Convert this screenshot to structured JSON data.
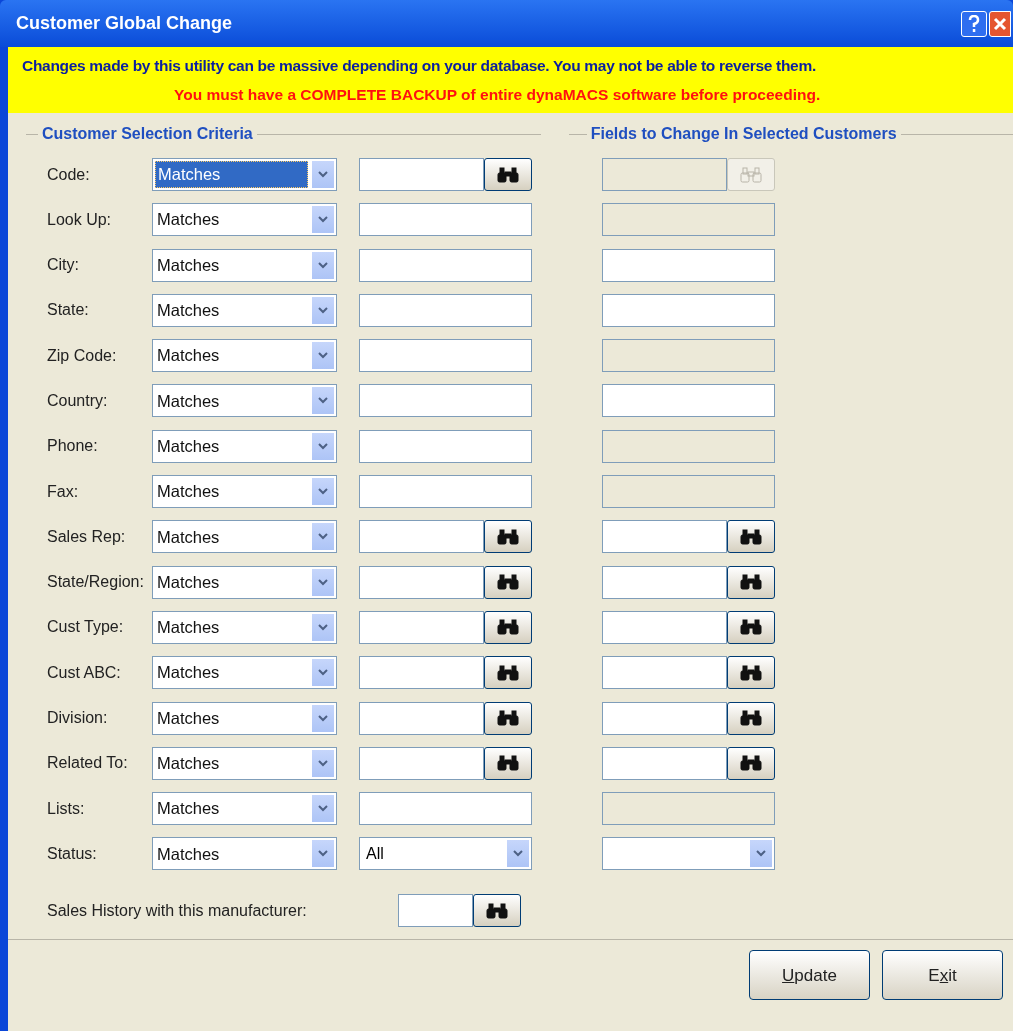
{
  "window": {
    "title": "Customer Global Change"
  },
  "warning": {
    "line_1": "Changes made by this utility can be massive depending on your database. You may not be able to reverse them.",
    "line_2": "You must have a COMPLETE BACKUP of entire dynaMACS software before proceeding."
  },
  "sections": {
    "selection_title": "Customer Selection Criteria",
    "change_title": "Fields to Change In Selected Customers"
  },
  "rows": [
    {
      "label": "Code:",
      "operator": "Matches",
      "operator_focused": true,
      "criteria": {
        "kind": "lookup",
        "disabled": false
      },
      "change": {
        "kind": "lookup",
        "disabled": true
      }
    },
    {
      "label": "Look Up:",
      "operator": "Matches",
      "operator_focused": false,
      "criteria": {
        "kind": "input",
        "disabled": false
      },
      "change": {
        "kind": "input",
        "disabled": true
      }
    },
    {
      "label": "City:",
      "operator": "Matches",
      "operator_focused": false,
      "criteria": {
        "kind": "input",
        "disabled": false
      },
      "change": {
        "kind": "input",
        "disabled": false
      }
    },
    {
      "label": "State:",
      "operator": "Matches",
      "operator_focused": false,
      "criteria": {
        "kind": "input",
        "disabled": false
      },
      "change": {
        "kind": "input",
        "disabled": false
      }
    },
    {
      "label": "Zip Code:",
      "operator": "Matches",
      "operator_focused": false,
      "criteria": {
        "kind": "input",
        "disabled": false
      },
      "change": {
        "kind": "input",
        "disabled": true
      }
    },
    {
      "label": "Country:",
      "operator": "Matches",
      "operator_focused": false,
      "criteria": {
        "kind": "input",
        "disabled": false
      },
      "change": {
        "kind": "input",
        "disabled": false
      }
    },
    {
      "label": "Phone:",
      "operator": "Matches",
      "operator_focused": false,
      "criteria": {
        "kind": "input",
        "disabled": false
      },
      "change": {
        "kind": "input",
        "disabled": true
      }
    },
    {
      "label": "Fax:",
      "operator": "Matches",
      "operator_focused": false,
      "criteria": {
        "kind": "input",
        "disabled": false
      },
      "change": {
        "kind": "input",
        "disabled": true
      }
    },
    {
      "label": "Sales Rep:",
      "operator": "Matches",
      "operator_focused": false,
      "criteria": {
        "kind": "lookup",
        "disabled": false
      },
      "change": {
        "kind": "lookup",
        "disabled": false
      }
    },
    {
      "label": "State/Region:",
      "operator": "Matches",
      "operator_focused": false,
      "criteria": {
        "kind": "lookup",
        "disabled": false
      },
      "change": {
        "kind": "lookup",
        "disabled": false
      }
    },
    {
      "label": "Cust Type:",
      "operator": "Matches",
      "operator_focused": false,
      "criteria": {
        "kind": "lookup",
        "disabled": false
      },
      "change": {
        "kind": "lookup",
        "disabled": false
      }
    },
    {
      "label": "Cust ABC:",
      "operator": "Matches",
      "operator_focused": false,
      "criteria": {
        "kind": "lookup",
        "disabled": false
      },
      "change": {
        "kind": "lookup",
        "disabled": false
      }
    },
    {
      "label": "Division:",
      "operator": "Matches",
      "operator_focused": false,
      "criteria": {
        "kind": "lookup",
        "disabled": false
      },
      "change": {
        "kind": "lookup",
        "disabled": false
      }
    },
    {
      "label": "Related To:",
      "operator": "Matches",
      "operator_focused": false,
      "criteria": {
        "kind": "lookup",
        "disabled": false
      },
      "change": {
        "kind": "lookup",
        "disabled": false
      }
    },
    {
      "label": "Lists:",
      "operator": "Matches",
      "operator_focused": false,
      "criteria": {
        "kind": "input",
        "disabled": false
      },
      "change": {
        "kind": "input",
        "disabled": true
      }
    },
    {
      "label": "Status:",
      "operator": "Matches",
      "operator_focused": false,
      "criteria": {
        "kind": "dropdown",
        "disabled": false,
        "value": "All"
      },
      "change": {
        "kind": "dropdown",
        "disabled": false
      }
    }
  ],
  "sales_history": {
    "label": "Sales History with this manufacturer:"
  },
  "buttons": [
    {
      "key": "U",
      "after": "pdate"
    },
    {
      "before": "E",
      "key": "x",
      "after": "it"
    }
  ]
}
